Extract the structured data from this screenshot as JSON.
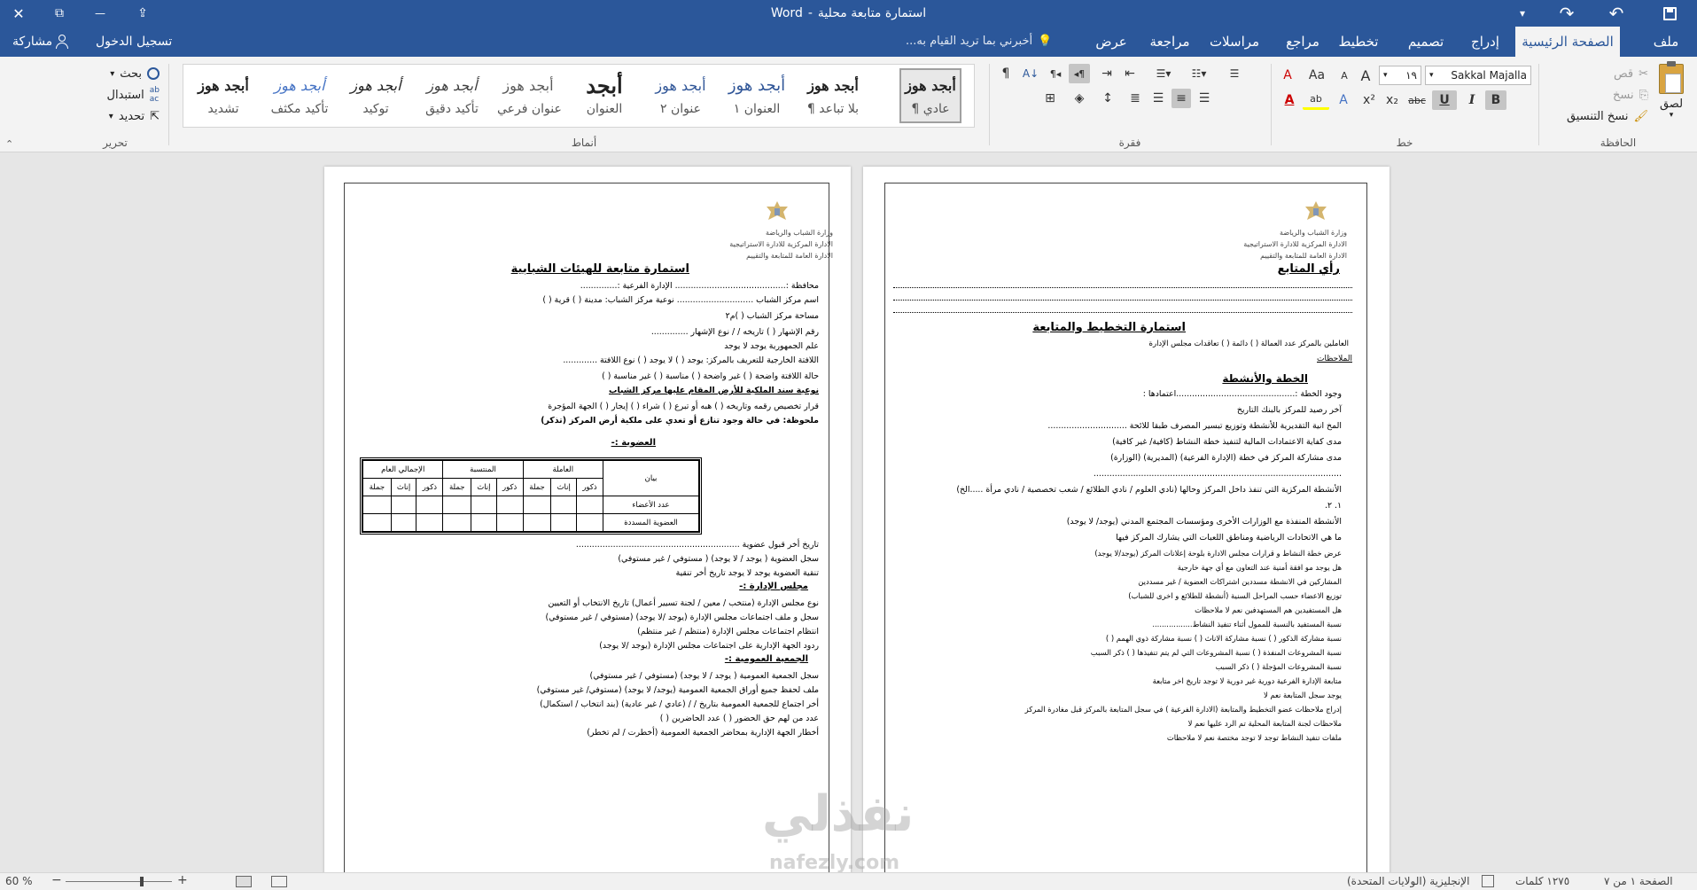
{
  "window": {
    "title": "استمارة متابعة محلية",
    "app_name": "Word",
    "separator": "-",
    "buttons": {
      "close": "✕",
      "restore": "⧉",
      "minimize": "—",
      "ribbon_display": "⇪",
      "pin": "▾"
    }
  },
  "qat": {
    "save": "💾",
    "redo": "↷",
    "undo": "↶",
    "customize": "▾"
  },
  "tabs": {
    "file": "ملف",
    "items": [
      "الصفحة الرئيسية",
      "إدراج",
      "تصميم",
      "تخطيط",
      "مراجع",
      "مراسلات",
      "مراجعة",
      "عرض"
    ],
    "active_index": 0,
    "tell_me": "أخبرني بما تريد القيام به...",
    "signin": "تسجيل الدخول",
    "share": "مشاركة"
  },
  "ribbon": {
    "clipboard": {
      "label": "الحافظة",
      "paste": "لصق",
      "cut": "قص",
      "copy": "نسخ",
      "format_painter": "نسخ التنسيق"
    },
    "font": {
      "label": "خط",
      "font_name": "Sakkal Majalla",
      "font_size": "١٩",
      "grow": "A",
      "shrink": "A",
      "case": "Aa",
      "clear": "A",
      "bold": "B",
      "italic": "I",
      "underline": "U",
      "strike": "abc",
      "subscript": "x₂",
      "superscript": "x²",
      "effects": "A",
      "highlight": "ab",
      "color": "A"
    },
    "paragraph": {
      "label": "فقرة"
    },
    "styles": {
      "label": "أنماط",
      "items": [
        {
          "preview": "أبجد هوز",
          "name": "¶ عادي"
        },
        {
          "preview": "أبجد هوز",
          "name": "¶ بلا تباعد"
        },
        {
          "preview": "أبجد هوز",
          "name": "العنوان ١"
        },
        {
          "preview": "أبجد هوز",
          "name": "عنوان ٢"
        },
        {
          "preview": "أبجد",
          "name": "العنوان"
        },
        {
          "preview": "أبجد هوز",
          "name": "عنوان فرعي"
        },
        {
          "preview": "أبجد هوز",
          "name": "تأكيد دقيق"
        },
        {
          "preview": "أبجد هوز",
          "name": "توكيد"
        },
        {
          "preview": "أبجد هوز",
          "name": "تأكيد مكثف"
        },
        {
          "preview": "أبجد هوز",
          "name": "تشديد"
        }
      ]
    },
    "editing": {
      "label": "تحرير",
      "find": "بحث",
      "replace": "استبدال",
      "select": "تحديد"
    }
  },
  "page_right": {
    "ministry": [
      "وزارة الشباب والرياضة",
      "الادارة المركزية للادارة الاستراتيجية",
      "الادارة العامة للمتابعة والتقييم"
    ],
    "opinion_title": "رأي المتابع",
    "form_title": "استمارة التخطيط والمتابعة",
    "workers_line": "العاملين بالمركز        عدد العمالة (        ) دائمة (        ) تعاقدات مجلس الإدارة",
    "notes": "الملاحظات",
    "plan_title": "الخطة والأنشطة",
    "lines": [
      "وجود الخطة :.............................................اعتمادها :",
      "آخر رصيد للمركز بالبنك                    التاريخ",
      "المخ انية التقديرية للأنشطة وتوزيع تبسير المصرف طبقا للائحة ..............................",
      "مدى كفاية الاعتمادات المالية لتنفيذ خطة النشاط (كافية/ غير كافية)",
      "مدى مشاركة المركز في خطة (الإدارة الفرعية) (المديرية) (الوزارة)",
      "..............................................................................................",
      "الأنشطة المركزية التي تنفذ داخل المركز وحالها (نادي العلوم / نادي الطلائع / شعب تخصصية / نادي مرأة .....الخ)",
      "١.                                                     ٢.",
      "الأنشطة المنفذة مع الوزارات الأخرى ومؤسسات المجتمع المدني (يوجد/ لا يوجد)",
      "ما هي الاتحادات الرياضية ومناطق اللعبات التي يشارك المركز فيها",
      "عرض خطة النشاط و قرارات مجلس الادارة بلوحة إعلانات المركز (يوجد/لا يوجد)",
      "هل يوجد مو افقة أمنية عند التعاون مع أي جهة خارجية",
      "المشاركين في الانشطة مسددين اشتراكات العضوية / غير مسددين",
      "توزيع الاعضاء حسب المراحل السنية (أنشطة للطلائع و اخرى للشباب)",
      "هل المستفيدين هم المستهدفين    نعم        لا        ملاحظات",
      "نسبة المستفيد بالنسبة للممول أثناء تنفيذ النشاط.................",
      "نسبة مشاركة الذكور (     ) نسبة مشاركة الاناث (     ) نسبة مشاركة ذوي الهمم (     )",
      "نسبة المشروعات المنفذة (     ) نسبة المشروعات التي لم يتم تنفيذها (     ) ذكر السبب",
      "نسبة المشروعات المؤجلة (     ) ذكر السبب",
      "متابعة الإدارة الفرعية دورية    غير دورية    لا توجد    تاريخ اخر متابعة",
      "يوجد سجل المتابعة        نعم            لا",
      "إدراج ملاحظات عضو التخطيط والمتابعة (الادارة الفرعية ) في سجل المتابعة بالمركز قبل مغادرة المركز",
      "ملاحظات لجنة المتابعة المحلية تم الرد عليها    نعم        لا",
      "ملفات تنفيذ النشاط  توجد  لا توجد   مختصة   نعم   لا   ملاحظات"
    ]
  },
  "page_left": {
    "ministry": [
      "وزارة الشباب والرياضة",
      "الادارة المركزية للادارة الاستراتيجية",
      "الادارة العامة للمتابعة والتقييم"
    ],
    "title": "استمارة متابعة للهيئات الشبابية",
    "lines": [
      "محافظة :..........................................        الإدارة الفرعية :..............",
      "اسم مركز الشباب .............................        نوعية مركز الشباب: مدينة (    ) قرية (    )",
      "مساحة مركز الشباب (          )م٢",
      "رقم الإشهار (          ) تاريخه    /    /         نوع الإشهار ..............",
      "علم الجمهورية      يوجد      لا يوجد",
      "اللافتة الخارجية للتعريف بالمركز: يوجد (    ) لا يوجد (    )    نوع اللافتة .............",
      "حالة اللافتة واضحة (    ) غير واضحة (    ) مناسبة (    ) غير مناسبة (    )",
      "نوعية سند الملكية للأرض المقام عليها مركز الشباب",
      "قرار تخصيص رقمه وتاريخه (         ) هبه أو تبرع (     ) شراء (     ) إيجار (     ) الجهة المؤجرة",
      "ملحوظة: في حالة وجود تنازع أو تعدي على ملكية أرض المركز (تذكر)"
    ],
    "membership_title": "العضوية :-",
    "table": {
      "row_header": "بيان",
      "groups": [
        "العاملة",
        "المنتسبة",
        "الإجمالي العام"
      ],
      "subheads": [
        "ذكور",
        "إناث",
        "جملة"
      ],
      "rows": [
        "عدد الأعضاء",
        "العضوية المسددة"
      ]
    },
    "lines2": [
      "تاريخ أخر قبول عضوية ..............................................................",
      "سجل العضوية ( يوجد / لا يوجد)    ( مستوفي / غير مستوفي)",
      "تنقية العضوية    يوجد        لا يوجد        تاريخ أخر تنقية"
    ],
    "board_title": "مجلس الإدارة :-",
    "lines3": [
      "نوع مجلس الإدارة (منتخب / معين / لجنة تسيير أعمال)        تاريخ الانتخاب أو التعيين",
      "سجل و ملف اجتماعات مجلس الإدارة (يوجد /لا يوجد)    (مستوفي / غير مستوفي)",
      "انتظام اجتماعات مجلس الإدارة (منتظم / غير منتظم)",
      "ردود الجهة الإدارية على اجتماعات مجلس الإدارة    (يوجد /لا يوجد)"
    ],
    "assembly_title": "الجمعية العمومية :-",
    "lines4": [
      "سجل الجمعية العمومية ( يوجد / لا يوجد) (مستوفي / غير مستوفي)",
      "ملف لحفظ جميع أوراق الجمعية العمومية (يوجد/ لا يوجد) (مستوفي/ غير مستوفي)",
      "أخر اجتماع للجمعية العمومية بتاريخ    /    /    (عادي / غير عادية) (بند انتخاب / استكمال)",
      "عدد من لهم حق الحضور (        ) عدد الحاضرين (        )",
      "أخطار الجهة الإدارية بمحاضر الجمعية العمومية (أخطرت / لم تخطر)"
    ]
  },
  "watermark": {
    "text": "نفذلي",
    "url": "nafezly.com"
  },
  "status": {
    "page": "الصفحة ١ من ٧",
    "words": "١٢٧٥ كلمات",
    "language": "الإنجليزية (الولايات المتحدة)",
    "zoom": "60 %"
  },
  "colors": {
    "brand": "#2b579a",
    "ribbon_bg": "#f3f3f3"
  }
}
